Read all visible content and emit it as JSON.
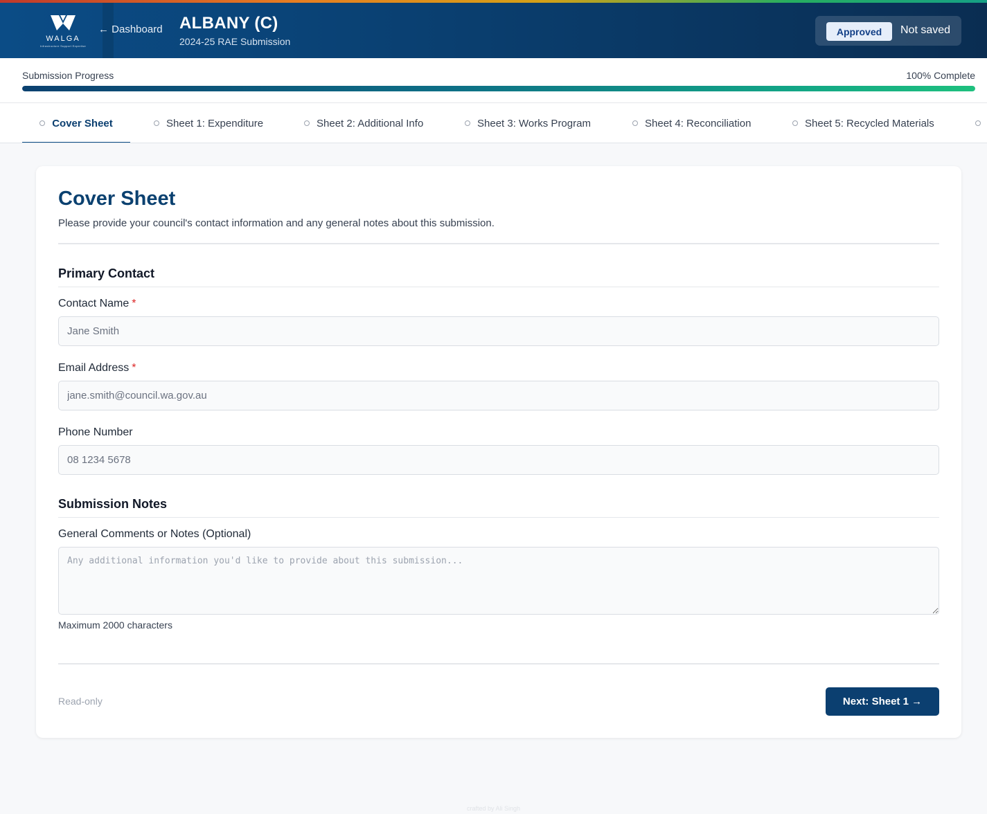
{
  "header": {
    "logo_text": "WALGA",
    "logo_subtext": "Infrastructure Support Expertise",
    "back_label": "← Dashboard",
    "council_name": "ALBANY (C)",
    "submission_label": "2024-25 RAE Submission",
    "status_badge": "Approved",
    "save_state": "Not saved"
  },
  "progress": {
    "label": "Submission Progress",
    "percent_label": "100% Complete",
    "value": 100
  },
  "tabs": [
    {
      "label": "Cover Sheet",
      "active": true
    },
    {
      "label": "Sheet 1: Expenditure",
      "active": false
    },
    {
      "label": "Sheet 2: Additional Info",
      "active": false
    },
    {
      "label": "Sheet 3: Works Program",
      "active": false
    },
    {
      "label": "Sheet 4: Reconciliation",
      "active": false
    },
    {
      "label": "Sheet 5: Recycled Materials",
      "active": false
    }
  ],
  "cover_sheet": {
    "title": "Cover Sheet",
    "description": "Please provide your council's contact information and any general notes about this submission.",
    "primary_contact": {
      "heading": "Primary Contact",
      "contact_name": {
        "label": "Contact Name",
        "required_mark": "*",
        "placeholder": "Jane Smith",
        "value": ""
      },
      "email": {
        "label": "Email Address",
        "required_mark": "*",
        "placeholder": "jane.smith@council.wa.gov.au",
        "value": ""
      },
      "phone": {
        "label": "Phone Number",
        "placeholder": "08 1234 5678",
        "value": ""
      }
    },
    "notes": {
      "heading": "Submission Notes",
      "label": "General Comments or Notes (Optional)",
      "placeholder": "Any additional information you'd like to provide about this submission...",
      "hint": "Maximum 2000 characters"
    },
    "footer": {
      "readonly_label": "Read-only",
      "next_button": "Next: Sheet 1 →"
    }
  },
  "credit": "crafted by Ali Singh",
  "colors": {
    "brand_navy": "#0b3f70",
    "approved_badge_bg": "#e6eefa",
    "required_red": "#dc2626"
  }
}
